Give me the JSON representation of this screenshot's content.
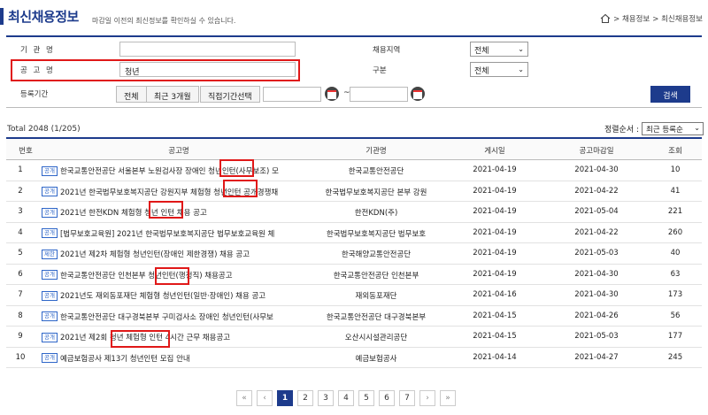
{
  "header": {
    "title": "최신채용정보",
    "subtitle": "마감일 이전의 최신정보를 확인하실 수 있습니다.",
    "breadcrumb": [
      "> 채용정보",
      "> 최신채용정보"
    ]
  },
  "search": {
    "org_label": "기 관 명",
    "org_value": "",
    "notice_label": "공 고 명",
    "notice_value": "청년",
    "period_label": "등록기간",
    "period_buttons": [
      "전체",
      "최근 3개월",
      "직접기간선택"
    ],
    "date_from": "",
    "date_to": "",
    "tilde": "~",
    "region_label": "채용지역",
    "region_value": "전체",
    "type_label": "구분",
    "type_value": "전체",
    "search_button": "검색"
  },
  "list_meta": {
    "total": "Total 2048 (1/205)",
    "sort_label": "정렬순서 :",
    "sort_value": "최근 등록순"
  },
  "table": {
    "headers": [
      "번호",
      "공고명",
      "기관명",
      "게시일",
      "공고마감일",
      "조회"
    ],
    "rows": [
      {
        "num": "1",
        "badge": "공개",
        "title": "한국교통안전공단 서울본부 노원검사장 장애인 청년인턴(사무보조) 모",
        "org": "한국교통안전공단",
        "posted": "2021-04-19",
        "deadline": "2021-04-30",
        "views": "10"
      },
      {
        "num": "2",
        "badge": "공개",
        "title": "2021년 한국법무보호복지공단 강원지부 체험형 청년인턴 공개경쟁채",
        "org": "한국법무보호복지공단 본부 강원",
        "posted": "2021-04-19",
        "deadline": "2021-04-22",
        "views": "41"
      },
      {
        "num": "3",
        "badge": "공개",
        "title": "2021년 한전KDN 체험형 청년 인턴 채용 공고",
        "org": "한전KDN(주)",
        "posted": "2021-04-19",
        "deadline": "2021-05-04",
        "views": "221"
      },
      {
        "num": "4",
        "badge": "공개",
        "title": "[법무보호교육원] 2021년 한국법무보호복지공단 법무보호교육원 체",
        "org": "한국법무보호복지공단 법무보호",
        "posted": "2021-04-19",
        "deadline": "2021-04-22",
        "views": "260"
      },
      {
        "num": "5",
        "badge": "제한",
        "title": "2021년 제2차 체험형 청년인턴(장애인 제한경쟁) 채용 공고",
        "org": "한국해양교통안전공단",
        "posted": "2021-04-19",
        "deadline": "2021-05-03",
        "views": "40"
      },
      {
        "num": "6",
        "badge": "공개",
        "title": "한국교통안전공단 인천본부 청년인턴(행정직) 채용공고",
        "org": "한국교통안전공단 인천본부",
        "posted": "2021-04-19",
        "deadline": "2021-04-30",
        "views": "63"
      },
      {
        "num": "7",
        "badge": "공개",
        "title": "2021년도 재외동포재단 체험형 청년인턴(일반·장애인) 채용 공고",
        "org": "재외동포재단",
        "posted": "2021-04-16",
        "deadline": "2021-04-30",
        "views": "173"
      },
      {
        "num": "8",
        "badge": "공개",
        "title": "한국교통안전공단 대구경북본부 구미검사소 장애인 청년인턴(사무보",
        "org": "한국교통안전공단 대구경북본부",
        "posted": "2021-04-15",
        "deadline": "2021-04-26",
        "views": "56"
      },
      {
        "num": "9",
        "badge": "공개",
        "title": "2021년 제2회 청년 체험형 인턴 4시간 근무 채용공고",
        "org": "오산시시설관리공단",
        "posted": "2021-04-15",
        "deadline": "2021-05-03",
        "views": "177"
      },
      {
        "num": "10",
        "badge": "공개",
        "title": "예금보험공사 제13기 청년인턴 모집 안내",
        "org": "예금보험공사",
        "posted": "2021-04-14",
        "deadline": "2021-04-27",
        "views": "245"
      }
    ]
  },
  "pagination": {
    "first": "«",
    "prev": "‹",
    "pages": [
      "1",
      "2",
      "3",
      "4",
      "5",
      "6",
      "7"
    ],
    "current": "1",
    "next": "›",
    "last": "»"
  },
  "colors": {
    "brand": "#1d3b8c",
    "highlight": "#e01818",
    "badge": "#2e66c8"
  }
}
